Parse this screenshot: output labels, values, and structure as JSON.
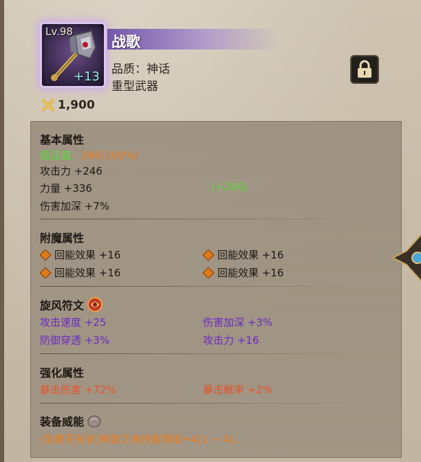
{
  "item": {
    "level": "Lv.98",
    "enhance": "+13",
    "name": "战歌",
    "quality": "品质：神话",
    "type": "重型武器",
    "price": "1,900"
  },
  "basic": {
    "title": "基本属性",
    "quality_label": "极品值：",
    "quality_value": "286(100%)",
    "atk": "攻击力 +246",
    "str": "力量 +336",
    "str_bonus": "(+286)",
    "dmg": "伤害加深 +7%"
  },
  "enchant": {
    "title": "附魔属性",
    "items": [
      "回能效果 +16",
      "回能效果 +16",
      "回能效果 +16",
      "回能效果 +16"
    ]
  },
  "rune": {
    "title": "旋风符文",
    "items": [
      "攻击速度 +25",
      "伤害加深 +3%",
      "防御穿透 +3%",
      "攻击力 +16"
    ]
  },
  "reinforce": {
    "title": "强化属性",
    "items": [
      "暴击伤害 +72%",
      "暴击概率 +2%"
    ]
  },
  "power": {
    "title": "装备威能",
    "desc": "(圣教军有效)奉献之地技能等级+4(1 ~ 4)。"
  },
  "colors": {
    "purple": "#6a2bc2",
    "orange": "#e87a1e",
    "green": "#5cd83a",
    "red": "#e8522a"
  }
}
